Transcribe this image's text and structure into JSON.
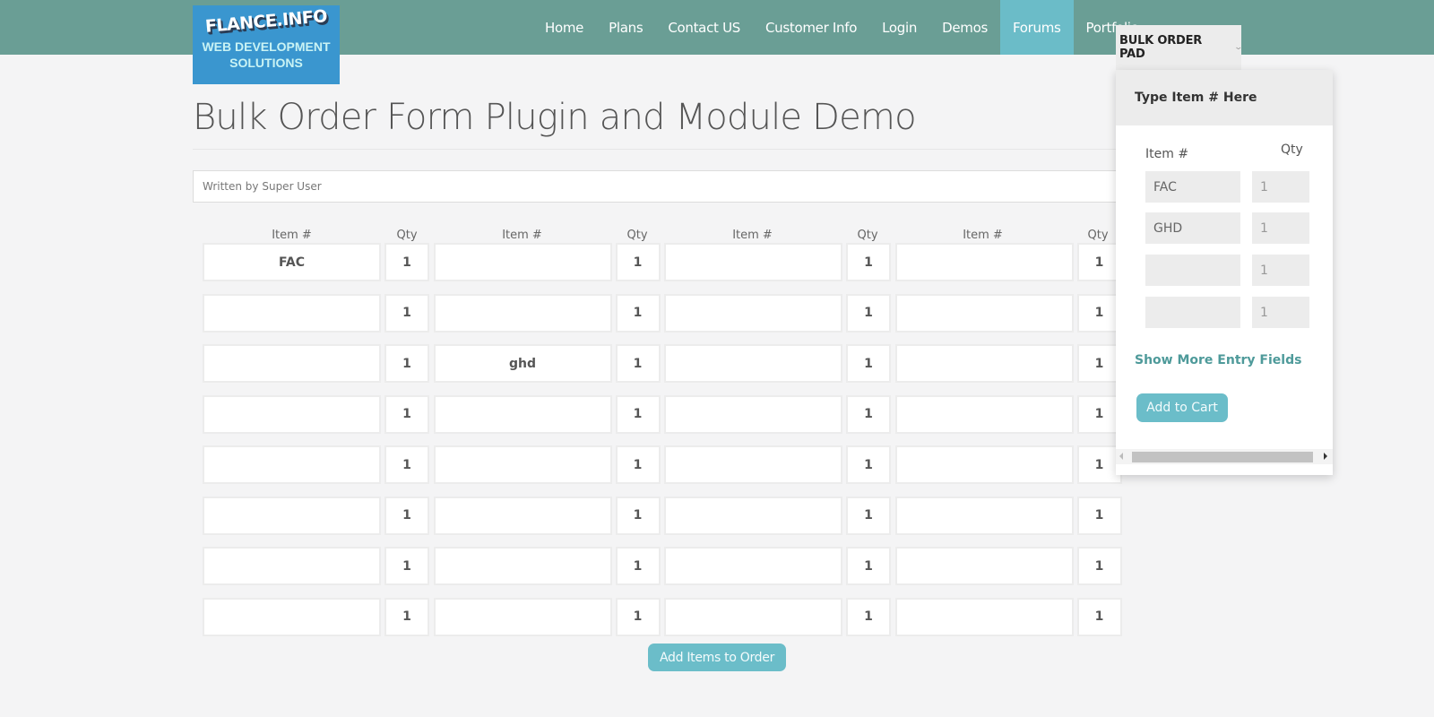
{
  "header": {
    "logo": {
      "title": "FLANCE.INFO",
      "subtitle_line1": "WEB DEVELOPMENT",
      "subtitle_line2": "SOLUTIONS"
    },
    "nav": [
      {
        "label": "Home",
        "active": false
      },
      {
        "label": "Plans",
        "active": false
      },
      {
        "label": "Contact US",
        "active": false
      },
      {
        "label": "Customer Info",
        "active": false
      },
      {
        "label": "Login",
        "active": false
      },
      {
        "label": "Demos",
        "active": false
      },
      {
        "label": "Forums",
        "active": true
      },
      {
        "label": "Portfolio",
        "active": false
      }
    ],
    "bulk_order_tab": {
      "label": "BULK ORDER PAD",
      "icon": "chevron-down-icon"
    },
    "colors": {
      "bar": "#6a9e95",
      "active": "#6bbcc8",
      "accent_button": "#6bbdc9"
    }
  },
  "main": {
    "title": "Bulk Order Form Plugin and Module Demo",
    "author": "Written by Super User",
    "grid": {
      "headers": {
        "item": "Item #",
        "qty": "Qty"
      },
      "rows": [
        [
          {
            "item": "FAC",
            "qty": "1"
          },
          {
            "item": "",
            "qty": "1"
          },
          {
            "item": "",
            "qty": "1"
          },
          {
            "item": "",
            "qty": "1"
          }
        ],
        [
          {
            "item": "",
            "qty": "1"
          },
          {
            "item": "",
            "qty": "1"
          },
          {
            "item": "",
            "qty": "1"
          },
          {
            "item": "",
            "qty": "1"
          }
        ],
        [
          {
            "item": "",
            "qty": "1"
          },
          {
            "item": "ghd",
            "qty": "1"
          },
          {
            "item": "",
            "qty": "1"
          },
          {
            "item": "",
            "qty": "1"
          }
        ],
        [
          {
            "item": "",
            "qty": "1"
          },
          {
            "item": "",
            "qty": "1"
          },
          {
            "item": "",
            "qty": "1"
          },
          {
            "item": "",
            "qty": "1"
          }
        ],
        [
          {
            "item": "",
            "qty": "1"
          },
          {
            "item": "",
            "qty": "1"
          },
          {
            "item": "",
            "qty": "1"
          },
          {
            "item": "",
            "qty": "1"
          }
        ],
        [
          {
            "item": "",
            "qty": "1"
          },
          {
            "item": "",
            "qty": "1"
          },
          {
            "item": "",
            "qty": "1"
          },
          {
            "item": "",
            "qty": "1"
          }
        ],
        [
          {
            "item": "",
            "qty": "1"
          },
          {
            "item": "",
            "qty": "1"
          },
          {
            "item": "",
            "qty": "1"
          },
          {
            "item": "",
            "qty": "1"
          }
        ],
        [
          {
            "item": "",
            "qty": "1"
          },
          {
            "item": "",
            "qty": "1"
          },
          {
            "item": "",
            "qty": "1"
          },
          {
            "item": "",
            "qty": "1"
          }
        ]
      ]
    },
    "add_items_button": "Add Items to Order"
  },
  "bulk_pad": {
    "heading": "Type Item # Here",
    "label_item": "Item #",
    "label_qty": "Qty",
    "entries": [
      {
        "item": "FAC",
        "qty": "1"
      },
      {
        "item": "GHD",
        "qty": "1"
      },
      {
        "item": "",
        "qty": "1"
      },
      {
        "item": "",
        "qty": "1"
      }
    ],
    "show_more": "Show More Entry Fields",
    "add_to_cart": "Add to Cart"
  }
}
